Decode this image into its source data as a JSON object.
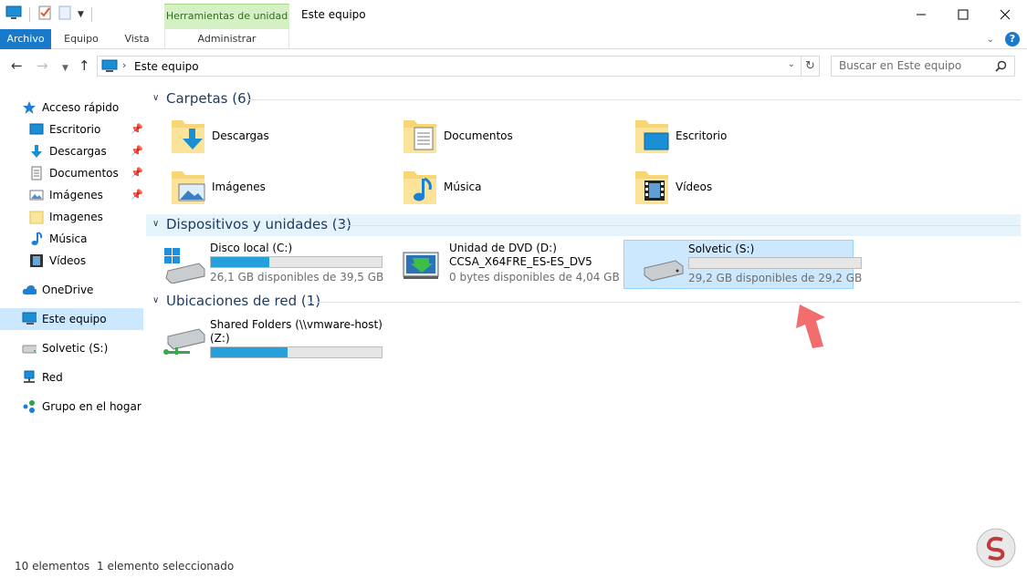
{
  "window": {
    "title": "Este equipo",
    "contextual_group_label": "Herramientas de unidad",
    "controls": {
      "minimize": "minimize-icon",
      "maximize": "maximize-icon",
      "close": "close-icon"
    }
  },
  "ribbon": {
    "tabs": [
      {
        "label": "Archivo"
      },
      {
        "label": "Equipo"
      },
      {
        "label": "Vista"
      },
      {
        "label": "Administrar"
      }
    ],
    "accent": "#1979ca",
    "contextual_color": "#d6f0c5",
    "help_label": "?"
  },
  "address": {
    "path": "Este equipo",
    "search_placeholder": "Buscar en Este equipo"
  },
  "nav": {
    "quick_access": "Acceso rápido",
    "items": [
      {
        "label": "Escritorio",
        "icon": "desktop-icon",
        "pinned": true
      },
      {
        "label": "Descargas",
        "icon": "download-arrow-icon",
        "pinned": true
      },
      {
        "label": "Documentos",
        "icon": "document-icon",
        "pinned": true
      },
      {
        "label": "Imágenes",
        "icon": "picture-icon",
        "pinned": true
      },
      {
        "label": "Imagenes",
        "icon": "folder-icon",
        "pinned": false
      },
      {
        "label": "Música",
        "icon": "music-note-icon",
        "pinned": false
      },
      {
        "label": "Vídeos",
        "icon": "film-icon",
        "pinned": false
      }
    ],
    "onedrive": "OneDrive",
    "this_pc": "Este equipo",
    "solvetic": "Solvetic (S:)",
    "network": "Red",
    "homegroup": "Grupo en el hogar"
  },
  "groups": {
    "folders": {
      "title": "Carpetas (6)"
    },
    "devices": {
      "title": "Dispositivos y unidades (3)"
    },
    "network": {
      "title": "Ubicaciones de red (1)"
    }
  },
  "folders": [
    {
      "label": "Descargas",
      "icon": "downloads-folder-icon"
    },
    {
      "label": "Documentos",
      "icon": "documents-folder-icon"
    },
    {
      "label": "Escritorio",
      "icon": "desktop-folder-icon"
    },
    {
      "label": "Imágenes",
      "icon": "pictures-folder-icon"
    },
    {
      "label": "Música",
      "icon": "music-folder-icon"
    },
    {
      "label": "Vídeos",
      "icon": "videos-folder-icon"
    }
  ],
  "drives": [
    {
      "name": "Disco local (C:)",
      "free": "26,1 GB disponibles de 39,5 GB",
      "used_fraction": 0.34,
      "icon": "windows-drive-icon"
    },
    {
      "name": "Unidad de DVD (D:)",
      "name2": "CCSA_X64FRE_ES-ES_DV5",
      "free": "0 bytes disponibles de 4,04 GB",
      "icon": "dvd-drive-icon"
    },
    {
      "name": "Solvetic (S:)",
      "free": "29,2 GB disponibles de 29,2 GB",
      "used_fraction": 0.0,
      "icon": "hard-drive-icon",
      "selected": true
    }
  ],
  "network_locations": [
    {
      "name": "Shared Folders (\\\\vmware-host)",
      "name2": "(Z:)",
      "used_fraction": 0.45,
      "icon": "network-drive-icon"
    }
  ],
  "status": {
    "count": "10 elementos",
    "selection": "1 elemento seleccionado"
  }
}
